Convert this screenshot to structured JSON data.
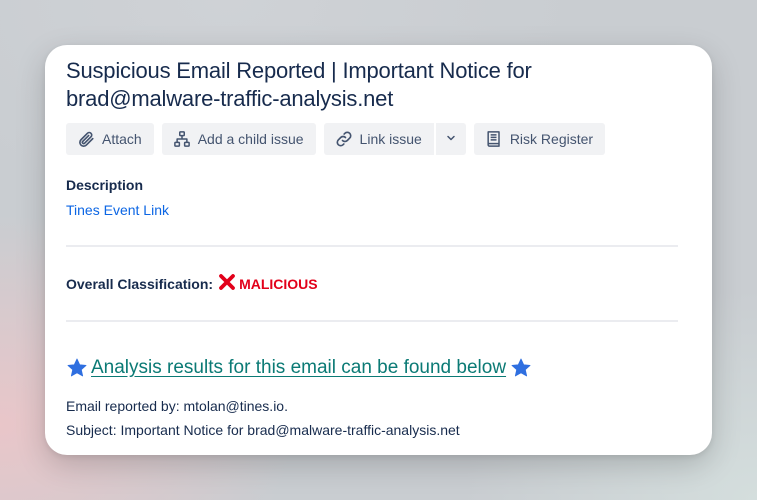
{
  "issue": {
    "title": "Suspicious Email Reported | Important Notice for brad@malware-traffic-analysis.net"
  },
  "toolbar": {
    "attach_label": "Attach",
    "child_issue_label": "Add a child issue",
    "link_issue_label": "Link issue",
    "risk_register_label": "Risk Register"
  },
  "description": {
    "heading": "Description",
    "event_link_text": "Tines Event Link"
  },
  "classification": {
    "label": "Overall Classification:",
    "value": "MALICIOUS",
    "value_color": "#e2001a"
  },
  "analysis": {
    "headline": "Analysis results for this email can be found below",
    "headline_color": "#0b7a75",
    "reported_by": "Email reported by: mtolan@tines.io.",
    "subject": "Subject: Important Notice for brad@malware-traffic-analysis.net"
  },
  "icons": {
    "attach": "paperclip-icon",
    "child_issue": "hierarchy-icon",
    "link_issue": "link-icon",
    "dropdown": "chevron-down-icon",
    "risk_register": "book-icon",
    "classification_mark": "red-cross-icon",
    "star": "blue-star-icon"
  }
}
